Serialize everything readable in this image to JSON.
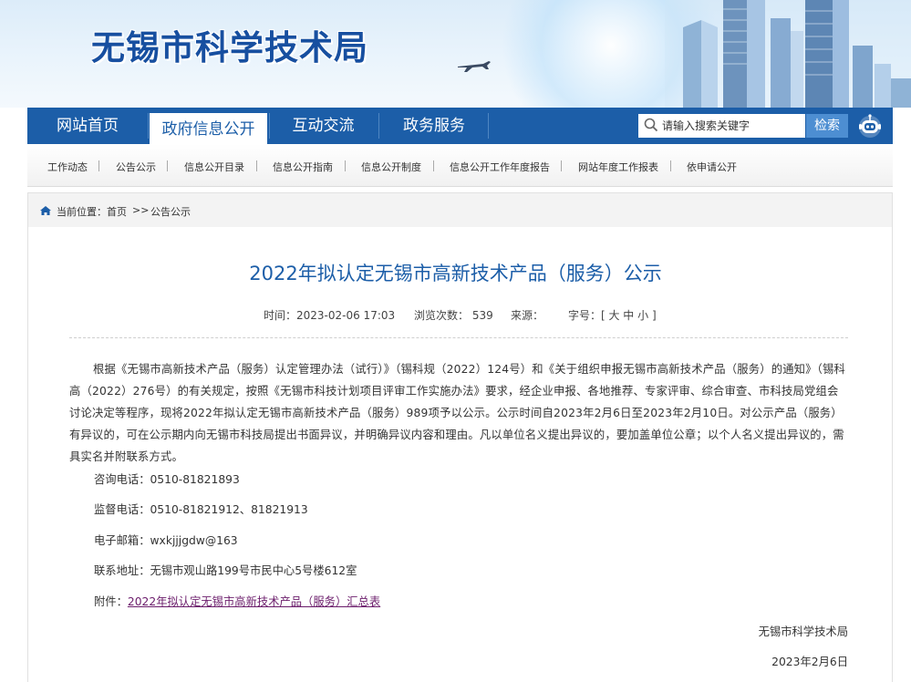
{
  "header": {
    "site_title": "无锡市科学技术局"
  },
  "nav": {
    "items": [
      {
        "label": "网站首页"
      },
      {
        "label": "政府信息公开",
        "active": true
      },
      {
        "label": "互动交流"
      },
      {
        "label": "政务服务"
      }
    ],
    "search_placeholder": "请输入搜索关键字",
    "search_button": "检索",
    "robot_icon": "robot-icon"
  },
  "subnav": {
    "items": [
      "工作动态",
      "公告公示",
      "信息公开目录",
      "信息公开指南",
      "信息公开制度",
      "信息公开工作年度报告",
      "网站年度工作报表",
      "依申请公开"
    ]
  },
  "breadcrumb": {
    "prefix": "当前位置：",
    "home": "首页",
    "sep": ">>",
    "current": "公告公示"
  },
  "article": {
    "title": "2022年拟认定无锡市高新技术产品（服务）公示",
    "time": "时间：2023-02-06 17:03",
    "views": "浏览次数： 539",
    "source": "来源：",
    "font_size": "字号：[ 大 中 小 ]",
    "paragraph": "根据《无锡市高新技术产品（服务）认定管理办法（试行）》（锡科规（2022）124号）和《关于组织申报无锡市高新技术产品（服务）的通知》（锡科高（2022）276号）的有关规定，按照《无锡市科技计划项目评审工作实施办法》要求，经企业申报、各地推荐、专家评审、综合审查、市科技局党组会讨论决定等程序，现将2022年拟认定无锡市高新技术产品（服务）989项予以公示。公示时间自2023年2月6日至2023年2月10日。对公示产品（服务）有异议的，可在公示期内向无锡市科技局提出书面异议，并明确异议内容和理由。凡以单位名义提出异议的，要加盖单位公章；以个人名义提出异议的，需具实名并附联系方式。",
    "phone": "咨询电话：0510-81821893",
    "supervise": "监督电话：0510-81821912、81821913",
    "email": "电子邮箱：wxkjjjgdw@163",
    "address": "联系地址：无锡市观山路199号市民中心5号楼612室",
    "attachment_label": "附件：",
    "attachment_link": "2022年拟认定无锡市高新技术产品（服务）汇总表",
    "signer": "无锡市科学技术局",
    "date": "2023年2月6日"
  },
  "colors": {
    "nav_bg": "#1c5ea8",
    "title_blue": "#1c5ea8",
    "link_purple": "#6b1c6b"
  }
}
